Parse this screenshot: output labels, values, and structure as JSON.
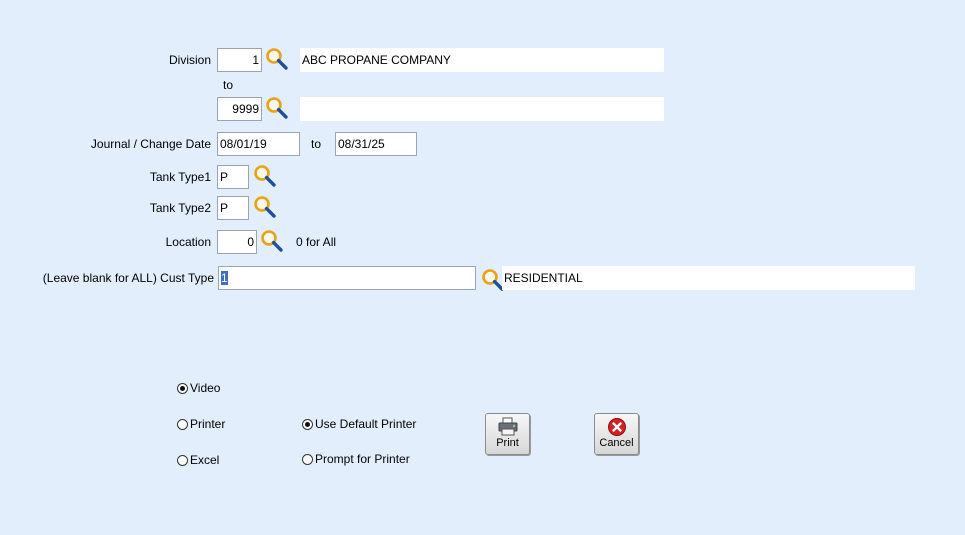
{
  "division": {
    "label": "Division",
    "from_value": "1",
    "from_name": "ABC PROPANE COMPANY",
    "to_label": "to",
    "to_value": "9999",
    "to_name": ""
  },
  "journal": {
    "label": "Journal / Change Date",
    "from_date": "08/01/19",
    "to_label": "to",
    "to_date": "08/31/25"
  },
  "tank_type1": {
    "label": "Tank Type1",
    "value": "P"
  },
  "tank_type2": {
    "label": "Tank Type2",
    "value": "P"
  },
  "location": {
    "label": "Location",
    "value": "0",
    "hint": "0 for All"
  },
  "cust_type": {
    "label": "(Leave blank for ALL) Cust Type",
    "value": "1",
    "name": "RESIDENTIAL"
  },
  "output": {
    "video": {
      "label": "Video",
      "selected": true
    },
    "printer": {
      "label": "Printer",
      "selected": false
    },
    "excel": {
      "label": "Excel",
      "selected": false
    },
    "use_default_printer": {
      "label": "Use Default Printer",
      "selected": true
    },
    "prompt_for_printer": {
      "label": "Prompt for Printer",
      "selected": false
    }
  },
  "buttons": {
    "print": {
      "label": "Print",
      "icon": "printer-icon"
    },
    "cancel": {
      "label": "Cancel",
      "icon": "cancel-icon",
      "color": "#d42020"
    }
  },
  "colors": {
    "background": "#e3eefd",
    "magnifier_rim": "#e8a21a",
    "magnifier_handle": "#1d4f9c"
  }
}
